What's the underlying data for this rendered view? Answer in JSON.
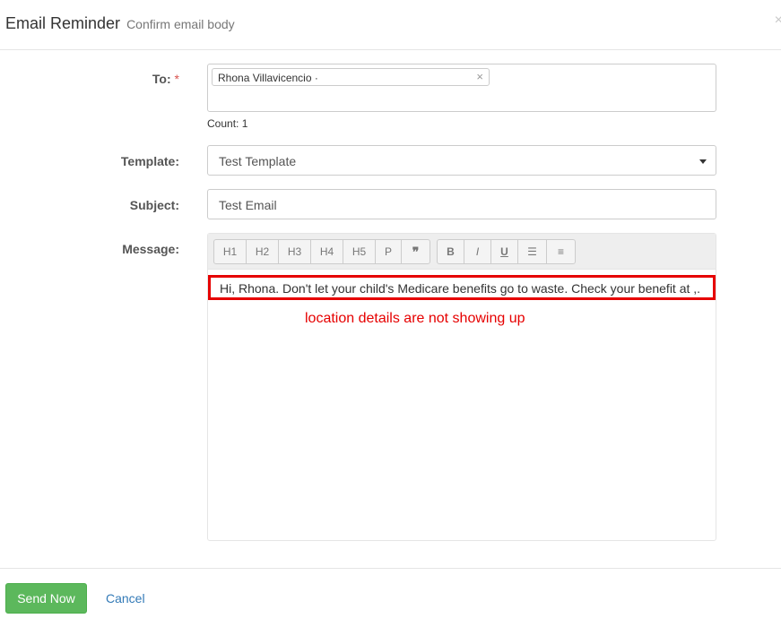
{
  "header": {
    "title": "Email Reminder",
    "subtitle": "Confirm email body",
    "close_symbol": "×"
  },
  "form": {
    "to": {
      "label": "To:",
      "required_marker": "*",
      "recipients": [
        {
          "name": "Rhona Villavicencio ·",
          "remove_symbol": "×"
        }
      ],
      "count": "Count: 1"
    },
    "template": {
      "label": "Template:",
      "selected": "Test Template"
    },
    "subject": {
      "label": "Subject:",
      "value": "Test Email"
    },
    "message": {
      "label": "Message:",
      "toolbar": {
        "headings": [
          "H1",
          "H2",
          "H3",
          "H4",
          "H5",
          "P",
          "❞"
        ],
        "formatting": [
          "B",
          "I",
          "U",
          "☰",
          "≡"
        ]
      },
      "body": "Hi, Rhona. Don't let your child's Medicare benefits go to waste. Check your benefit at ,."
    }
  },
  "annotation": "location details are not showing up",
  "footer": {
    "send_label": "Send Now",
    "cancel_label": "Cancel"
  },
  "colors": {
    "primary_success": "#5cb85c",
    "link": "#337ab7",
    "annotation_red": "#e60000"
  }
}
